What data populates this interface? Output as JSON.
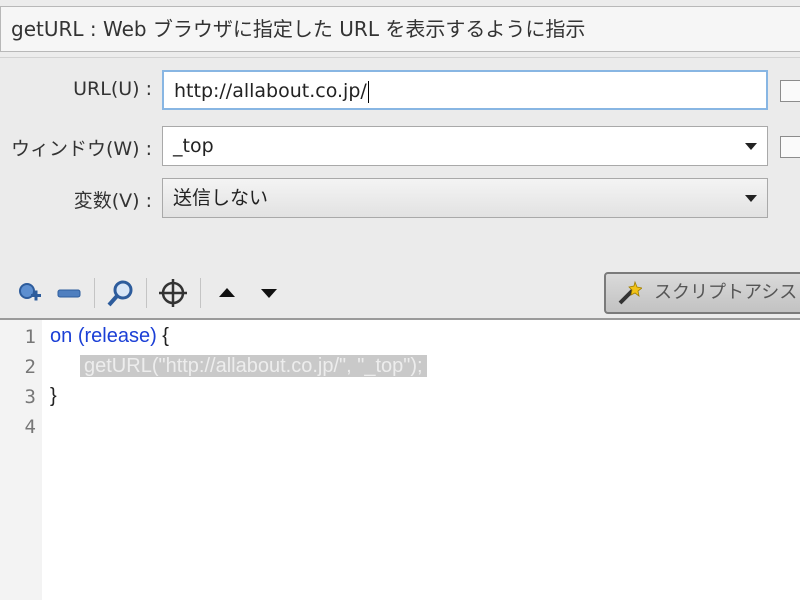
{
  "description": "getURL : Web ブラウザに指定した URL を表示するように指示",
  "params": {
    "url": {
      "label": "URL(U) :",
      "value": "http://allabout.co.jp/"
    },
    "window": {
      "label": "ウィンドウ(W) :",
      "value": "_top"
    },
    "variables": {
      "label": "変数(V) :",
      "value": "送信しない"
    }
  },
  "toolbar": {
    "script_assist_label": "スクリプトアシスト"
  },
  "editor": {
    "line_numbers": [
      "1",
      "2",
      "3",
      "4"
    ],
    "line1_keyword": "on",
    "line1_event": "(release)",
    "line1_brace": "{",
    "line2_code": "getURL(\"http://allabout.co.jp/\", \"_top\");",
    "line3_brace": "}"
  },
  "colors": {
    "keyword": "#1b3fd6",
    "highlight": "#c9c9c9",
    "focus_border": "#88b6e3"
  },
  "icons": [
    "add-icon",
    "remove-icon",
    "search-icon",
    "target-icon",
    "move-up-icon",
    "move-down-icon",
    "magic-wand-icon"
  ]
}
